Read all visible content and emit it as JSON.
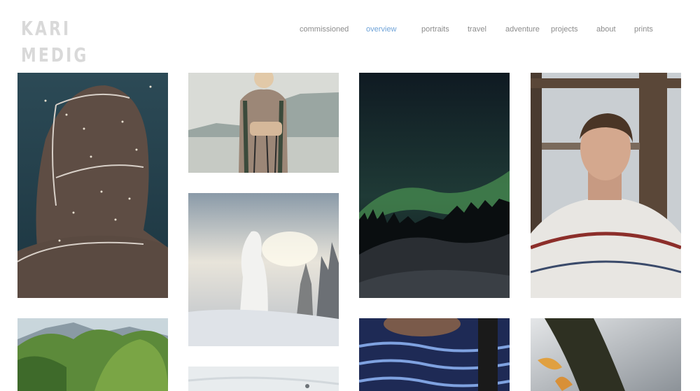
{
  "logo": {
    "line1": "KARI",
    "line2": "MEDIG"
  },
  "nav": {
    "items": [
      {
        "label": "commissioned",
        "active": false
      },
      {
        "label": "overview",
        "active": true
      },
      {
        "label": "portraits",
        "active": false
      },
      {
        "label": "travel",
        "active": false
      },
      {
        "label": "adventure",
        "active": false
      },
      {
        "label": "projects",
        "active": false
      },
      {
        "label": "about",
        "active": false
      },
      {
        "label": "prints",
        "active": false
      }
    ],
    "active_color": "#6fa3d8",
    "text_color": "#8c8c8c"
  },
  "gallery": {
    "photos": [
      {
        "subject": "hooded figure covered in mosquitoes facing water"
      },
      {
        "subject": "woman hiker holding trekking poles by a lake"
      },
      {
        "subject": "northern lights over forest silhouette at night"
      },
      {
        "subject": "young man in nordic patterned sweater by a window"
      },
      {
        "subject": "snow-covered trees in sunlit winter fog"
      },
      {
        "subject": "green trees by a river with mountains"
      },
      {
        "subject": "blue knitted garment with backpack strap"
      },
      {
        "subject": "fish held against a cloudy sky"
      },
      {
        "subject": "snow field with tracks"
      }
    ]
  }
}
